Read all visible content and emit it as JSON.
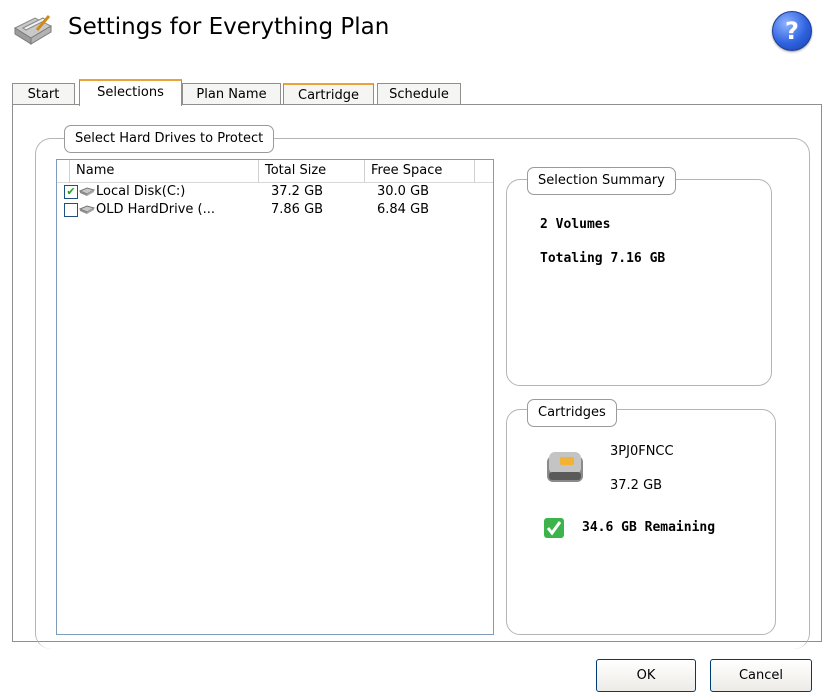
{
  "window": {
    "title": "Settings for Everything Plan",
    "help_icon": "help-icon",
    "help_label": "?"
  },
  "tabs": [
    {
      "label": "Start"
    },
    {
      "label": "Selections",
      "active": true
    },
    {
      "label": "Plan Name"
    },
    {
      "label": "Cartridge"
    },
    {
      "label": "Schedule"
    }
  ],
  "drives_group": {
    "legend": "Select Hard Drives to Protect",
    "columns": [
      "Name",
      "Total Size",
      "Free Space"
    ],
    "rows": [
      {
        "checked": true,
        "name": "Local Disk(C:)",
        "total": "37.2 GB",
        "free": "30.0 GB"
      },
      {
        "checked": false,
        "name": "OLD HardDrive (...",
        "total": "7.86 GB",
        "free": "6.84 GB"
      }
    ]
  },
  "summary": {
    "legend": "Selection Summary",
    "volumes": "2 Volumes",
    "total": "Totaling 7.16 GB"
  },
  "cartridges": {
    "legend": "Cartridges",
    "id": "3PJ0FNCC",
    "size": "37.2 GB",
    "remaining": "34.6 GB Remaining",
    "status_color": "#3cb44b"
  },
  "buttons": {
    "ok": "OK",
    "cancel": "Cancel"
  },
  "colors": {
    "accent_tab": "#e8a33a",
    "list_border": "#7f9db9"
  }
}
